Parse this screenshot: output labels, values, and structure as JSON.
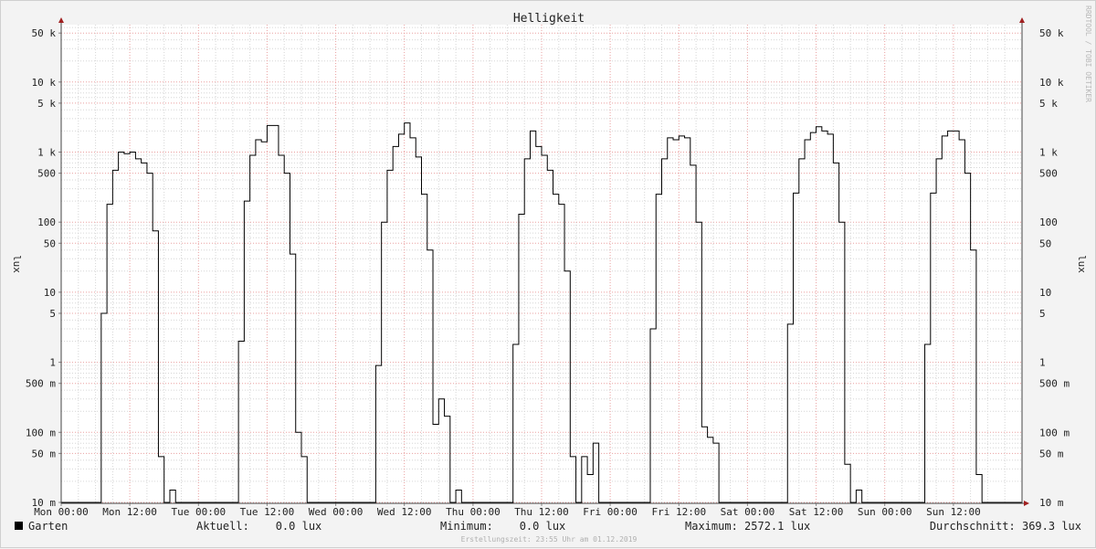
{
  "chart_data": {
    "type": "line",
    "title": "Helligkeit",
    "ylabel": "lux",
    "y_scale": "log",
    "ylim": [
      0.01,
      75000
    ],
    "xlim_hours": [
      0,
      168
    ],
    "x_ticks": [
      "Mon 00:00",
      "Mon 12:00",
      "Tue 00:00",
      "Tue 12:00",
      "Wed 00:00",
      "Wed 12:00",
      "Thu 00:00",
      "Thu 12:00",
      "Fri 00:00",
      "Fri 12:00",
      "Sat 00:00",
      "Sat 12:00",
      "Sun 00:00",
      "Sun 12:00"
    ],
    "y_ticks": [
      {
        "value": 0.01,
        "label": "10 m"
      },
      {
        "value": 0.05,
        "label": "50 m"
      },
      {
        "value": 0.1,
        "label": "100 m"
      },
      {
        "value": 0.5,
        "label": "500 m"
      },
      {
        "value": 1,
        "label": "1"
      },
      {
        "value": 5,
        "label": "5"
      },
      {
        "value": 10,
        "label": "10"
      },
      {
        "value": 50,
        "label": "50"
      },
      {
        "value": 100,
        "label": "100"
      },
      {
        "value": 500,
        "label": "500"
      },
      {
        "value": 1000,
        "label": "1 k"
      },
      {
        "value": 5000,
        "label": "5 k"
      },
      {
        "value": 10000,
        "label": "10 k"
      },
      {
        "value": 50000,
        "label": "50 k"
      }
    ],
    "grid": true,
    "legend_position": "bottom-left",
    "series": [
      {
        "name": "Garten",
        "color": "#000000",
        "points": [
          [
            0,
            0.01
          ],
          [
            7,
            0.01
          ],
          [
            7,
            5
          ],
          [
            8,
            5
          ],
          [
            8,
            180
          ],
          [
            9,
            180
          ],
          [
            9,
            550
          ],
          [
            10,
            550
          ],
          [
            10,
            1000
          ],
          [
            11,
            1000
          ],
          [
            11,
            950
          ],
          [
            12,
            950
          ],
          [
            12,
            1000
          ],
          [
            13,
            1000
          ],
          [
            13,
            800
          ],
          [
            14,
            800
          ],
          [
            14,
            700
          ],
          [
            15,
            700
          ],
          [
            15,
            500
          ],
          [
            16,
            500
          ],
          [
            16,
            75
          ],
          [
            17,
            75
          ],
          [
            17,
            0.045
          ],
          [
            18,
            0.045
          ],
          [
            18,
            0.01
          ],
          [
            19,
            0.01
          ],
          [
            19,
            0.015
          ],
          [
            20,
            0.015
          ],
          [
            20,
            0.01
          ],
          [
            31,
            0.01
          ],
          [
            31,
            2
          ],
          [
            32,
            2
          ],
          [
            32,
            200
          ],
          [
            33,
            200
          ],
          [
            33,
            900
          ],
          [
            34,
            900
          ],
          [
            34,
            1500
          ],
          [
            35,
            1500
          ],
          [
            35,
            1400
          ],
          [
            36,
            1400
          ],
          [
            36,
            2400
          ],
          [
            38,
            2400
          ],
          [
            38,
            900
          ],
          [
            39,
            900
          ],
          [
            39,
            500
          ],
          [
            40,
            500
          ],
          [
            40,
            35
          ],
          [
            41,
            35
          ],
          [
            41,
            0.1
          ],
          [
            42,
            0.1
          ],
          [
            42,
            0.045
          ],
          [
            43,
            0.045
          ],
          [
            43,
            0.01
          ],
          [
            55,
            0.01
          ],
          [
            55,
            0.9
          ],
          [
            56,
            0.9
          ],
          [
            56,
            100
          ],
          [
            57,
            100
          ],
          [
            57,
            550
          ],
          [
            58,
            550
          ],
          [
            58,
            1200
          ],
          [
            59,
            1200
          ],
          [
            59,
            1800
          ],
          [
            60,
            1800
          ],
          [
            60,
            2600
          ],
          [
            61,
            2600
          ],
          [
            61,
            1600
          ],
          [
            62,
            1600
          ],
          [
            62,
            850
          ],
          [
            63,
            850
          ],
          [
            63,
            250
          ],
          [
            64,
            250
          ],
          [
            64,
            40
          ],
          [
            65,
            40
          ],
          [
            65,
            0.13
          ],
          [
            66,
            0.13
          ],
          [
            66,
            0.3
          ],
          [
            67,
            0.3
          ],
          [
            67,
            0.17
          ],
          [
            68,
            0.17
          ],
          [
            68,
            0.01
          ],
          [
            69,
            0.01
          ],
          [
            69,
            0.015
          ],
          [
            70,
            0.015
          ],
          [
            70,
            0.01
          ],
          [
            79,
            0.01
          ],
          [
            79,
            1.8
          ],
          [
            80,
            1.8
          ],
          [
            80,
            130
          ],
          [
            81,
            130
          ],
          [
            81,
            800
          ],
          [
            82,
            800
          ],
          [
            82,
            2000
          ],
          [
            83,
            2000
          ],
          [
            83,
            1200
          ],
          [
            84,
            1200
          ],
          [
            84,
            900
          ],
          [
            85,
            900
          ],
          [
            85,
            550
          ],
          [
            86,
            550
          ],
          [
            86,
            250
          ],
          [
            87,
            250
          ],
          [
            87,
            180
          ],
          [
            88,
            180
          ],
          [
            88,
            20
          ],
          [
            89,
            20
          ],
          [
            89,
            0.045
          ],
          [
            90,
            0.045
          ],
          [
            90,
            0.01
          ],
          [
            91,
            0.01
          ],
          [
            91,
            0.045
          ],
          [
            92,
            0.045
          ],
          [
            92,
            0.025
          ],
          [
            93,
            0.025
          ],
          [
            93,
            0.07
          ],
          [
            94,
            0.07
          ],
          [
            94,
            0.01
          ],
          [
            103,
            0.01
          ],
          [
            103,
            3
          ],
          [
            104,
            3
          ],
          [
            104,
            250
          ],
          [
            105,
            250
          ],
          [
            105,
            800
          ],
          [
            106,
            800
          ],
          [
            106,
            1600
          ],
          [
            107,
            1600
          ],
          [
            107,
            1500
          ],
          [
            108,
            1500
          ],
          [
            108,
            1700
          ],
          [
            109,
            1700
          ],
          [
            109,
            1600
          ],
          [
            110,
            1600
          ],
          [
            110,
            650
          ],
          [
            111,
            650
          ],
          [
            111,
            100
          ],
          [
            112,
            100
          ],
          [
            112,
            0.12
          ],
          [
            113,
            0.12
          ],
          [
            113,
            0.085
          ],
          [
            114,
            0.085
          ],
          [
            114,
            0.07
          ],
          [
            115,
            0.07
          ],
          [
            115,
            0.01
          ],
          [
            127,
            0.01
          ],
          [
            127,
            3.5
          ],
          [
            128,
            3.5
          ],
          [
            128,
            260
          ],
          [
            129,
            260
          ],
          [
            129,
            800
          ],
          [
            130,
            800
          ],
          [
            130,
            1500
          ],
          [
            131,
            1500
          ],
          [
            131,
            1900
          ],
          [
            132,
            1900
          ],
          [
            132,
            2300
          ],
          [
            133,
            2300
          ],
          [
            133,
            2000
          ],
          [
            134,
            2000
          ],
          [
            134,
            1800
          ],
          [
            135,
            1800
          ],
          [
            135,
            700
          ],
          [
            136,
            700
          ],
          [
            136,
            100
          ],
          [
            137,
            100
          ],
          [
            137,
            0.035
          ],
          [
            138,
            0.035
          ],
          [
            138,
            0.01
          ],
          [
            139,
            0.01
          ],
          [
            139,
            0.015
          ],
          [
            140,
            0.015
          ],
          [
            140,
            0.01
          ],
          [
            151,
            0.01
          ],
          [
            151,
            1.8
          ],
          [
            152,
            1.8
          ],
          [
            152,
            260
          ],
          [
            153,
            260
          ],
          [
            153,
            800
          ],
          [
            154,
            800
          ],
          [
            154,
            1700
          ],
          [
            155,
            1700
          ],
          [
            155,
            2000
          ],
          [
            157,
            2000
          ],
          [
            157,
            1500
          ],
          [
            158,
            1500
          ],
          [
            158,
            500
          ],
          [
            159,
            500
          ],
          [
            159,
            40
          ],
          [
            160,
            40
          ],
          [
            160,
            0.025
          ],
          [
            161,
            0.025
          ],
          [
            161,
            0.01
          ],
          [
            168,
            0.01
          ]
        ]
      }
    ]
  },
  "footer": {
    "series_name": "Garten",
    "aktuell": "Aktuell:    0.0 lux",
    "minimum": "Minimum:    0.0 lux",
    "maximum": "Maximum: 2572.1 lux",
    "durchschnitt": "Durchschnitt: 369.3 lux",
    "timestamp": "Erstellungszeit: 23:55 Uhr am 01.12.2019"
  },
  "watermark": "RRDTOOL / TOBI OETIKER"
}
